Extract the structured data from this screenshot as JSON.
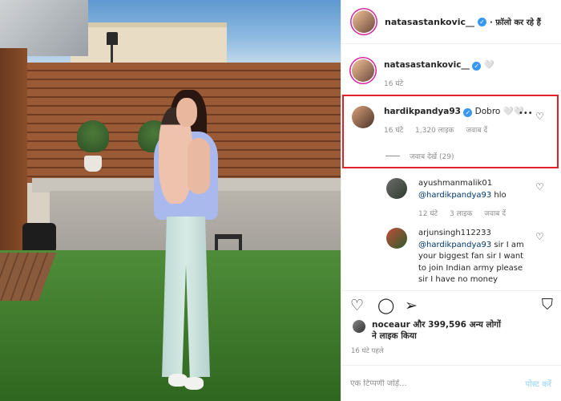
{
  "post": {
    "author": "natasastankovic__",
    "follow_text": "· फ़ॉलो कर रहे हैं",
    "verified_mark": "✓"
  },
  "caption": {
    "user": "natasastankovic__",
    "text": "🤍",
    "time": "16 घंटे"
  },
  "highlighted_comment": {
    "user": "hardikpandya93",
    "text": "Dobro 🤍🤍",
    "time": "16 घंटे",
    "likes": "1,320 लाइक",
    "reply": "जवाब दें",
    "more": "•••",
    "view_replies": "जवाब देखें (29)"
  },
  "replies": [
    {
      "user": "ayushmanmalik01",
      "mention": "@hardikpandya93",
      "text": " hlo",
      "time": "12 घंटे",
      "likes": "3 लाइक",
      "reply": "जवाब दें"
    },
    {
      "user": "arjunsingh112233",
      "mention": "@hardikpandya93",
      "text": " sir I am your biggest fan sir I want to join Indian army please sir I have no money"
    }
  ],
  "likes": {
    "line1": "noceaur और 399,596 अन्य लोगों",
    "line2": "ने लाइक किया"
  },
  "timestamp": "16 घंटे पहले",
  "composer": {
    "placeholder": "एक टिप्पणी जोड़ें...",
    "post_label": "पोस्ट करें"
  },
  "icons": {
    "heart": "♡",
    "comment": "◯",
    "share": "➢",
    "save": "⛉"
  },
  "colors": {
    "highlight_border": "#e0222a",
    "verified": "#3897f0",
    "link": "#00376b"
  }
}
